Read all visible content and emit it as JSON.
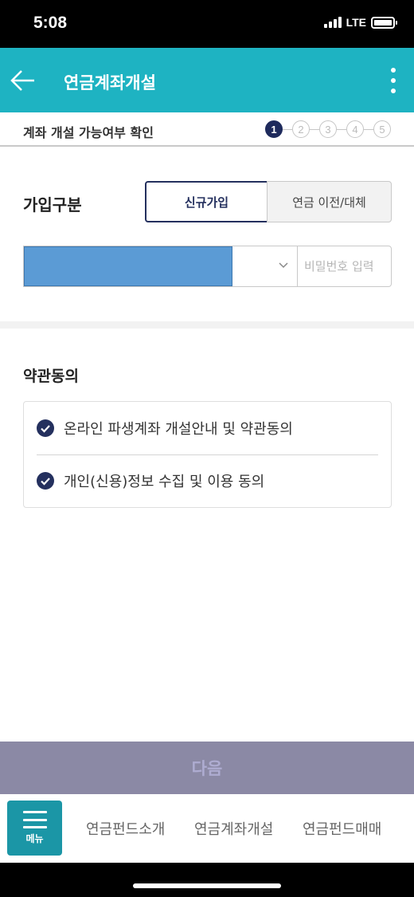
{
  "status_bar": {
    "time": "5:08",
    "network": "LTE"
  },
  "header": {
    "title": "연금계좌개설",
    "back_icon": "arrow-left-icon",
    "more_icon": "more-vertical-icon",
    "color": "#1eb3c2"
  },
  "steps": {
    "title": "계좌 개설 가능여부 확인",
    "items": [
      "1",
      "2",
      "3",
      "4",
      "5"
    ],
    "current": "1"
  },
  "join_type": {
    "label": "가입구분",
    "options": [
      "신규가입",
      "연금 이전/대체"
    ],
    "selected": "신규가입"
  },
  "account": {
    "password_placeholder": "비밀번호 입력",
    "chevron_icon": "chevron-down-icon"
  },
  "terms": {
    "title": "약관동의",
    "items": [
      {
        "label": "온라인 파생계좌 개설안내 및 약관동의",
        "checked": true
      },
      {
        "label": "개인(신용)정보 수집 및 이용 동의",
        "checked": true
      }
    ]
  },
  "next_button": {
    "label": "다음"
  },
  "bottom_nav": {
    "menu_label": "메뉴",
    "menu_icon": "hamburger-icon",
    "items": [
      "연금펀드소개",
      "연금계좌개설",
      "연금펀드매매"
    ]
  }
}
